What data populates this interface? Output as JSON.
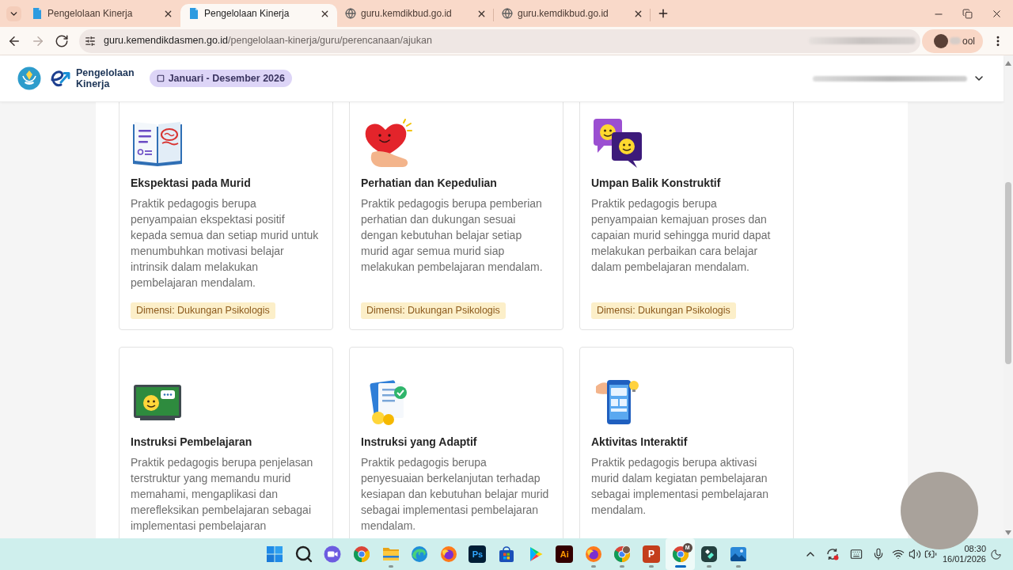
{
  "browser": {
    "tabs": [
      {
        "title": "Pengelolaan Kinerja",
        "kind": "app",
        "selected": false
      },
      {
        "title": "Pengelolaan Kinerja",
        "kind": "app",
        "selected": true
      },
      {
        "title": "guru.kemdikbud.go.id",
        "kind": "site",
        "selected": false
      },
      {
        "title": "guru.kemdikbud.go.id",
        "kind": "site",
        "selected": false
      }
    ],
    "nav": [
      {
        "kind": "back",
        "disabled": false
      },
      {
        "kind": "forward",
        "disabled": true
      },
      {
        "kind": "reload",
        "disabled": false
      }
    ],
    "address": "guru.kemendikdasmen.go.id/pengelolaan-kinerja/guru/perencanaan/ajukan",
    "profile_label": "ool"
  },
  "header": {
    "logo_text": "Pengelolaan Kinerja",
    "period": "Januari - Desember 2026"
  },
  "cards": [
    {
      "kind": "book",
      "title": "Ekspektasi pada Murid",
      "description": "Praktik pedagogis berupa penyampaian ekspektasi positif kepada semua dan setiap murid untuk menumbuhkan motivasi belajar intrinsik dalam melakukan pembelajaran mendalam.",
      "badge": "Dimensi: Dukungan Psikologis"
    },
    {
      "kind": "heart",
      "title": "Perhatian dan Kepedulian",
      "description": "Praktik pedagogis berupa pemberian perhatian dan dukungan sesuai dengan kebutuhan belajar setiap murid agar semua murid siap melakukan pembelajaran mendalam.",
      "badge": "Dimensi: Dukungan Psikologis"
    },
    {
      "kind": "chat",
      "title": "Umpan Balik Konstruktif",
      "description": "Praktik pedagogis berupa penyampaian kemajuan proses dan capaian murid sehingga murid dapat melakukan perbaikan cara belajar dalam pembelajaran mendalam.",
      "badge": "Dimensi: Dukungan Psikologis"
    },
    {
      "kind": "chalkboard",
      "title": "Instruksi Pembelajaran",
      "description": "Praktik pedagogis berupa penjelasan terstruktur yang memandu murid memahami, mengaplikasi dan merefleksikan pembelajaran sebagai implementasi pembelajaran"
    },
    {
      "kind": "documents",
      "title": "Instruksi yang Adaptif",
      "description": "Praktik pedagogis berupa penyesuaian berkelanjutan terhadap kesiapan dan kebutuhan belajar murid sebagai implementasi pembelajaran mendalam."
    },
    {
      "kind": "phone",
      "title": "Aktivitas Interaktif",
      "description": "Praktik pedagogis berupa aktivasi murid dalam kegiatan pembelajaran sebagai implementasi pembelajaran mendalam."
    }
  ],
  "taskbar": {
    "apps": [
      {
        "kind": "start",
        "running": false,
        "selected": false
      },
      {
        "kind": "search",
        "running": false,
        "selected": false
      },
      {
        "kind": "meet",
        "running": false,
        "selected": false
      },
      {
        "kind": "browser",
        "running": false,
        "selected": false
      },
      {
        "kind": "folder",
        "running": true,
        "selected": false
      },
      {
        "kind": "edge",
        "running": false,
        "selected": false
      },
      {
        "kind": "firefox",
        "running": false,
        "selected": false
      },
      {
        "kind": "ps",
        "label": "Ps",
        "running": false,
        "selected": false
      },
      {
        "kind": "store",
        "running": false,
        "selected": false
      },
      {
        "kind": "play",
        "running": false,
        "selected": false
      },
      {
        "kind": "ai",
        "label": "Ai",
        "running": false,
        "selected": false
      },
      {
        "kind": "firefox",
        "running": true,
        "selected": false
      },
      {
        "kind": "browser_avatar",
        "running": true,
        "selected": false
      },
      {
        "kind": "ppt",
        "label": "P",
        "running": true,
        "selected": false
      },
      {
        "kind": "browser_badge",
        "label": "M",
        "running": true,
        "selected": true
      },
      {
        "kind": "filmora",
        "running": true,
        "selected": false
      },
      {
        "kind": "photos",
        "running": true,
        "selected": false
      }
    ],
    "time": "08:30",
    "date": "16/01/2026"
  }
}
